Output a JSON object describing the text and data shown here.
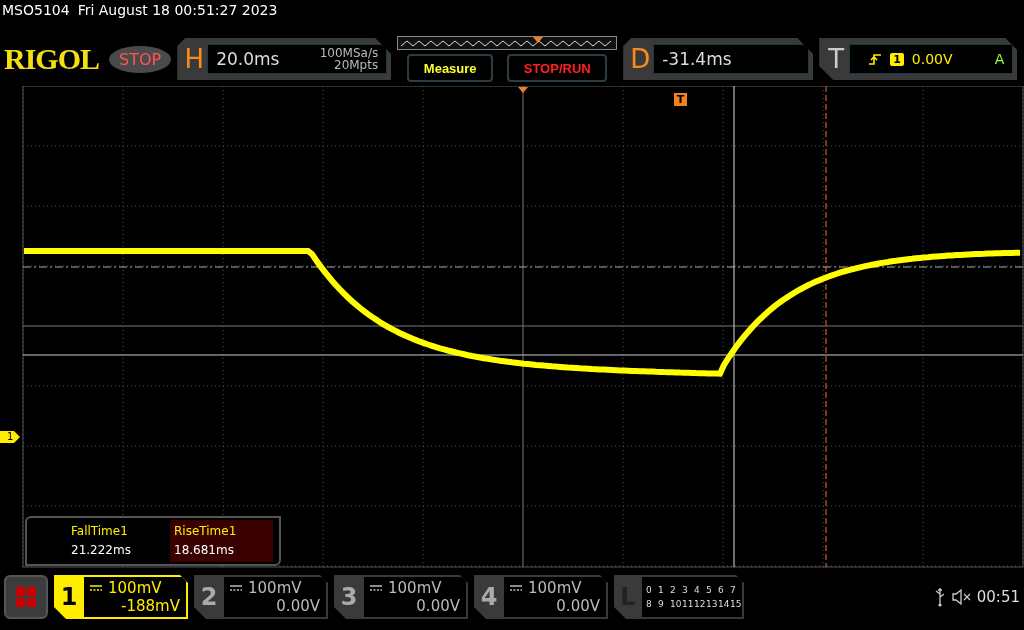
{
  "status_header": {
    "model": "MSO5104",
    "datetime": "Fri August 18 00:51:27 2023"
  },
  "toolbar": {
    "logo": "RIGOL",
    "run_state": "STOP",
    "horizontal": {
      "label": "H",
      "timebase": "20.0ms",
      "sample_rate": "100MSa/s",
      "memory_depth": "20Mpts"
    },
    "buttons": [
      {
        "label": "Measure",
        "kind": "measure"
      },
      {
        "label": "STOP/RUN",
        "kind": "run"
      }
    ],
    "delay": {
      "label": "D",
      "value": "-31.4ms"
    },
    "trigger": {
      "label": "T",
      "source": "1",
      "level": "0.00V",
      "mode": "A"
    }
  },
  "graticule": {
    "trigger_position_marker": "T",
    "channel_marker": "1"
  },
  "measurements": [
    {
      "name": "FallTime1",
      "value": "21.222ms",
      "selected": false
    },
    {
      "name": "RiseTime1",
      "value": "18.681ms",
      "selected": true
    }
  ],
  "channels": [
    {
      "number": "1",
      "scale": "100mV",
      "offset": "-188mV",
      "active": true
    },
    {
      "number": "2",
      "scale": "100mV",
      "offset": "0.00V",
      "active": false
    },
    {
      "number": "3",
      "scale": "100mV",
      "offset": "0.00V",
      "active": false
    },
    {
      "number": "4",
      "scale": "100mV",
      "offset": "0.00V",
      "active": false
    }
  ],
  "logic": {
    "label": "L",
    "rows": [
      [
        "0",
        "1",
        "2",
        "3",
        "4",
        "5",
        "6",
        "7"
      ],
      [
        "8",
        "9",
        "10",
        "11",
        "12",
        "13",
        "14",
        "15"
      ]
    ]
  },
  "status_bar": {
    "time": "00:51"
  }
}
